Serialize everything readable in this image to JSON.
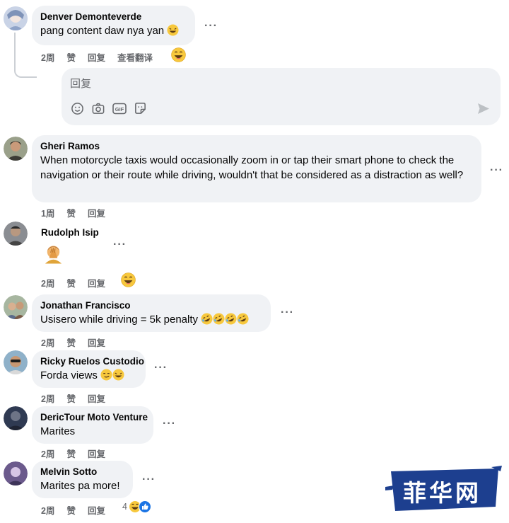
{
  "comments": [
    {
      "author": "Denver Demonteverde",
      "text": "pang content daw nya yan",
      "age": "2周",
      "like": "赞",
      "reply": "回复",
      "translate": "查看翻译"
    },
    {
      "author": "Gheri Ramos",
      "text": "When motorcycle taxis would occasionally zoom in or tap their smart phone to check the navigation or their route while driving, wouldn't that be considered as a distraction as well?",
      "age": "1周",
      "like": "赞",
      "reply": "回复"
    },
    {
      "author": "Rudolph Isip",
      "text": "",
      "age": "2周",
      "like": "赞",
      "reply": "回复"
    },
    {
      "author": "Jonathan Francisco",
      "text": "Usisero while driving = 5k penalty",
      "age": "2周",
      "like": "赞",
      "reply": "回复"
    },
    {
      "author": "Ricky Ruelos Custodio",
      "text": "Forda views",
      "age": "2周",
      "like": "赞",
      "reply": "回复"
    },
    {
      "author": "DericTour Moto Venture",
      "text": "Marites",
      "age": "2周",
      "like": "赞",
      "reply": "回复"
    },
    {
      "author": "Melvin Sotto",
      "text": "Marites pa more!",
      "age": "2周",
      "like": "赞",
      "reply": "回复",
      "reaction_count": "4"
    }
  ],
  "reply_box": {
    "placeholder": "回复"
  },
  "more_label": "···",
  "watermark": "菲华网",
  "icons": [
    "smiley-icon",
    "camera-icon",
    "gif-icon",
    "sticker-icon",
    "send-icon",
    "laughing-emoji-icon",
    "rofl-emoji-icon",
    "like-reaction-icon"
  ]
}
